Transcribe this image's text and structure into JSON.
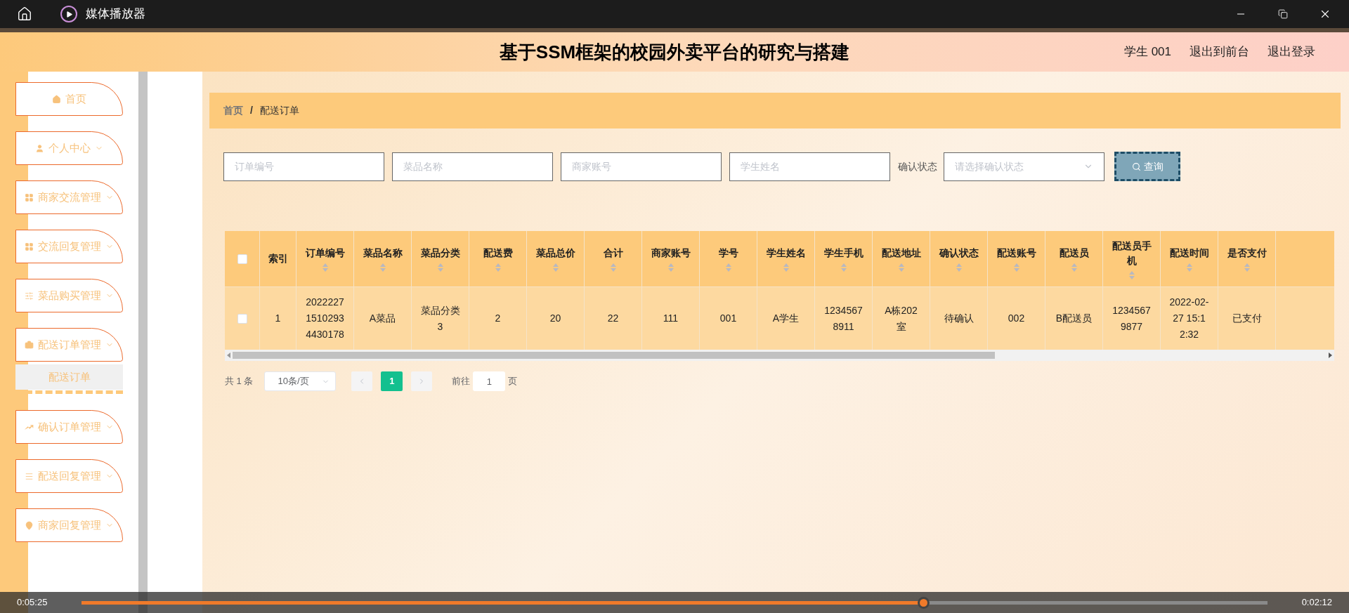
{
  "window": {
    "title": "媒体播放器"
  },
  "header": {
    "title": "基于SSM框架的校园外卖平台的研究与搭建",
    "user": "学生 001",
    "links": [
      "退出到前台",
      "退出登录"
    ]
  },
  "sidebar": {
    "items": [
      {
        "label": "首页",
        "kind": "link"
      },
      {
        "label": "个人中心",
        "kind": "menu"
      },
      {
        "label": "商家交流管理",
        "kind": "menu"
      },
      {
        "label": "交流回复管理",
        "kind": "menu"
      },
      {
        "label": "菜品购买管理",
        "kind": "menu"
      },
      {
        "label": "配送订单管理",
        "kind": "menu",
        "children": [
          {
            "label": "配送订单",
            "selected": true
          }
        ]
      },
      {
        "label": "确认订单管理",
        "kind": "menu"
      },
      {
        "label": "配送回复管理",
        "kind": "menu"
      },
      {
        "label": "商家回复管理",
        "kind": "menu"
      }
    ]
  },
  "breadcrumb": {
    "items": [
      "首页",
      "配送订单"
    ],
    "separator": "/"
  },
  "filters": [
    {
      "kind": "input",
      "placeholder": "订单编号"
    },
    {
      "kind": "input",
      "placeholder": "菜品名称"
    },
    {
      "kind": "input",
      "placeholder": "商家账号"
    },
    {
      "kind": "input",
      "placeholder": "学生姓名"
    },
    {
      "kind": "select",
      "label": "确认状态",
      "placeholder": "请选择确认状态"
    }
  ],
  "search_button": "查询",
  "table": {
    "select_all": false,
    "columns": [
      {
        "label": "索引",
        "sortable": false
      },
      {
        "label": "订单编号",
        "sortable": true
      },
      {
        "label": "菜品名称",
        "sortable": true
      },
      {
        "label": "菜品分类",
        "sortable": true
      },
      {
        "label": "配送费",
        "sortable": true
      },
      {
        "label": "菜品总价",
        "sortable": true
      },
      {
        "label": "合计",
        "sortable": true
      },
      {
        "label": "商家账号",
        "sortable": true
      },
      {
        "label": "学号",
        "sortable": true
      },
      {
        "label": "学生姓名",
        "sortable": true
      },
      {
        "label": "学生手机",
        "sortable": true
      },
      {
        "label": "配送地址",
        "sortable": true
      },
      {
        "label": "确认状态",
        "sortable": true
      },
      {
        "label": "配送账号",
        "sortable": true
      },
      {
        "label": "配送员",
        "sortable": true
      },
      {
        "label": "配送员手机",
        "sortable": true
      },
      {
        "label": "配送时间",
        "sortable": true
      },
      {
        "label": "是否支付",
        "sortable": true
      }
    ],
    "rows": [
      {
        "selected": false,
        "cells": [
          "1",
          "202222715102934430178",
          "A菜品",
          "菜品分类3",
          "2",
          "20",
          "22",
          "111",
          "001",
          "A学生",
          "12345678911",
          "A栋202室",
          "待确认",
          "002",
          "B配送员",
          "12345679877",
          "2022-02-27 15:12:32",
          "已支付"
        ]
      }
    ]
  },
  "pagination": {
    "total": "共 1 条",
    "page_size": "10条/页",
    "pages": [
      {
        "label": "1",
        "selected": true
      }
    ],
    "goto_label": "前往",
    "goto_value": "1",
    "goto_suffix": "页"
  },
  "player": {
    "elapsed": "0:05:25",
    "remaining": "0:02:12",
    "level": 0.71
  }
}
